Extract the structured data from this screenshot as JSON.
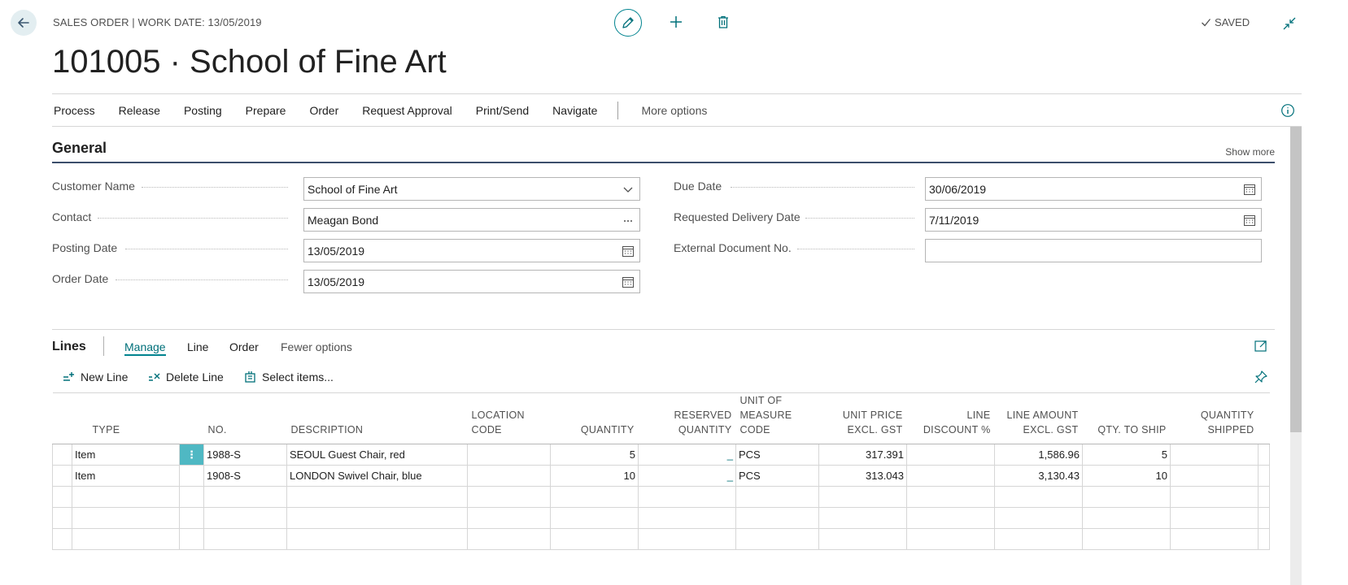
{
  "header": {
    "caption": "SALES ORDER | WORK DATE: 13/05/2019",
    "title": "101005 · School of Fine Art",
    "saved_label": "SAVED"
  },
  "actions": [
    "Process",
    "Release",
    "Posting",
    "Prepare",
    "Order",
    "Request Approval",
    "Print/Send",
    "Navigate"
  ],
  "more_options": "More options",
  "general": {
    "title": "General",
    "show_more": "Show more",
    "left_fields": [
      {
        "label": "Customer Name",
        "value": "School of Fine Art",
        "icon": "chevron-down-icon"
      },
      {
        "label": "Contact",
        "value": "Meagan Bond",
        "icon": "ellipsis-icon"
      },
      {
        "label": "Posting Date",
        "value": "13/05/2019",
        "icon": "calendar-icon"
      },
      {
        "label": "Order Date",
        "value": "13/05/2019",
        "icon": "calendar-icon"
      }
    ],
    "right_fields": [
      {
        "label": "Due Date",
        "value": "30/06/2019",
        "icon": "calendar-icon"
      },
      {
        "label": "Requested Delivery Date",
        "value": "7/11/2019",
        "icon": "calendar-icon"
      },
      {
        "label": "External Document No.",
        "value": "",
        "icon": ""
      }
    ]
  },
  "lines": {
    "title": "Lines",
    "tabs": [
      "Manage",
      "Line",
      "Order",
      "Fewer options"
    ],
    "subactions": [
      "New Line",
      "Delete Line",
      "Select items..."
    ],
    "columns": [
      "Type",
      "No.",
      "Description",
      "Location Code",
      "Quantity",
      "Reserved Quantity",
      "Unit of Measure Code",
      "Unit Price Excl. GST",
      "Line Discount %",
      "Line Amount Excl. GST",
      "Qty. to Ship",
      "Quantity Shipped"
    ],
    "rows": [
      {
        "type": "Item",
        "no": "1988-S",
        "description": "SEOUL Guest Chair, red",
        "location": "",
        "quantity": "5",
        "reserved": "_",
        "uom": "PCS",
        "unit_price": "317.391",
        "discount": "",
        "amount": "1,586.96",
        "qty_to_ship": "5",
        "qty_shipped": ""
      },
      {
        "type": "Item",
        "no": "1908-S",
        "description": "LONDON Swivel Chair, blue",
        "location": "",
        "quantity": "10",
        "reserved": "_",
        "uom": "PCS",
        "unit_price": "313.043",
        "discount": "",
        "amount": "3,130.43",
        "qty_to_ship": "10",
        "qty_shipped": ""
      }
    ],
    "row_menu_glyph": "⋮"
  }
}
